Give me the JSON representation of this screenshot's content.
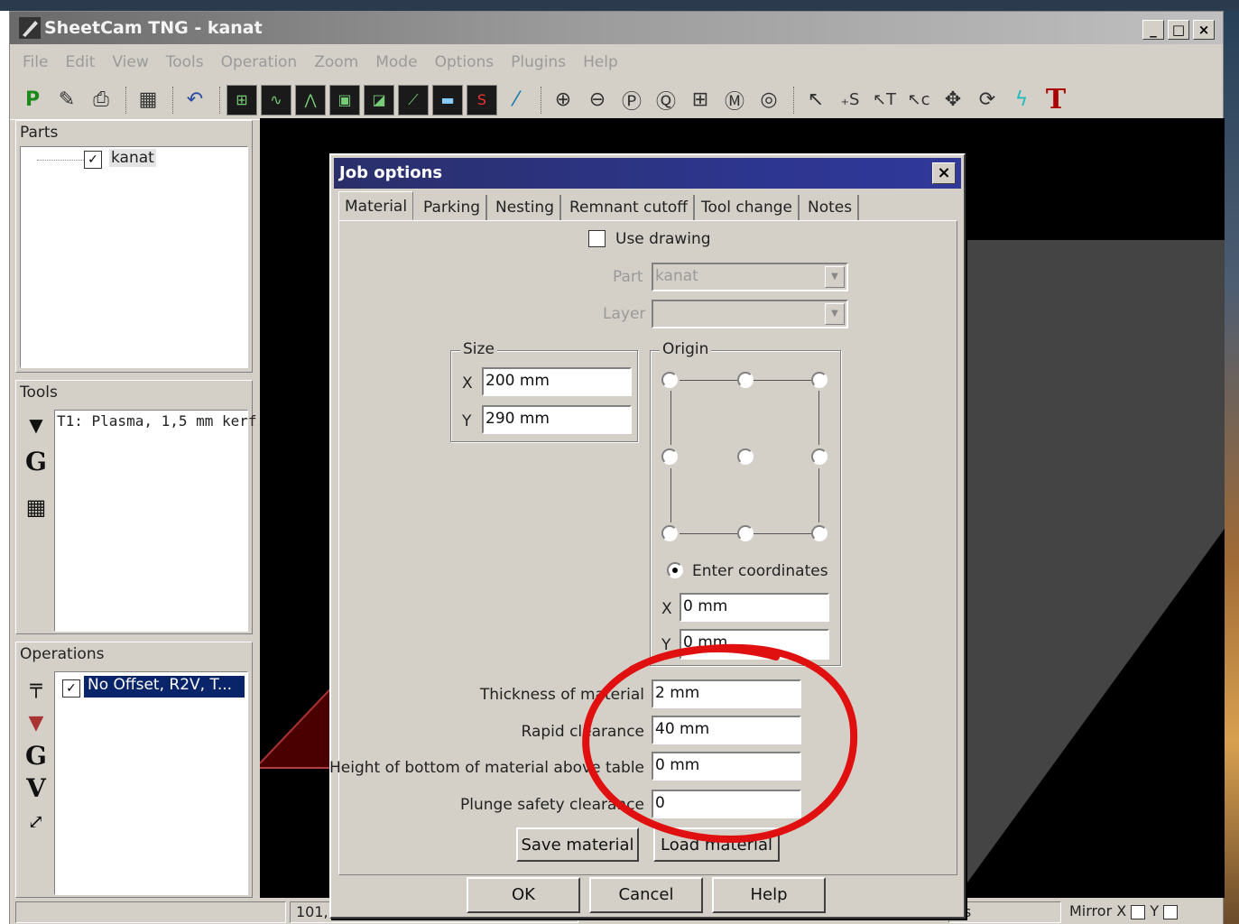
{
  "window": {
    "title": "SheetCam TNG - kanat",
    "caption_buttons": [
      "_",
      "□",
      "×"
    ]
  },
  "menu": [
    "File",
    "Edit",
    "View",
    "Tools",
    "Operation",
    "Zoom",
    "Mode",
    "Options",
    "Plugins",
    "Help"
  ],
  "parts": {
    "header": "Parts",
    "item": "kanat"
  },
  "tools": {
    "header": "Tools",
    "item": "T1: Plasma, 1,5 mm kerf"
  },
  "operations": {
    "header": "Operations",
    "item": "No Offset, R2V, T..."
  },
  "statusbar": {
    "coords": "101,",
    "es": "es",
    "mirror_x": "Mirror X",
    "y": "Y"
  },
  "dialog": {
    "title": "Job options",
    "close": "×",
    "tabs": [
      "Material",
      "Parking",
      "Nesting",
      "Remnant cutoff",
      "Tool change",
      "Notes"
    ],
    "use_drawing": "Use drawing",
    "part_label": "Part",
    "part_value": "kanat",
    "layer_label": "Layer",
    "size": {
      "label": "Size",
      "x_label": "X",
      "x_value": "200 mm",
      "y_label": "Y",
      "y_value": "290 mm"
    },
    "origin": {
      "label": "Origin",
      "enter_coords": "Enter coordinates",
      "x_label": "X",
      "x_value": "0 mm",
      "y_label": "Y",
      "y_value": "0 mm"
    },
    "thickness_label": "Thickness of material",
    "thickness_value": "2 mm",
    "rapid_label": "Rapid clearance",
    "rapid_value": "40 mm",
    "height_label": "Height of bottom of material above table",
    "height_value": "0 mm",
    "plunge_label": "Plunge safety clearance",
    "plunge_value": "0",
    "save_material": "Save material",
    "load_material": "Load material",
    "ok": "OK",
    "cancel": "Cancel",
    "help": "Help"
  },
  "colors": {
    "titlebar": "#2d3690",
    "annotation": "#e01010",
    "canvas": "#000000"
  }
}
